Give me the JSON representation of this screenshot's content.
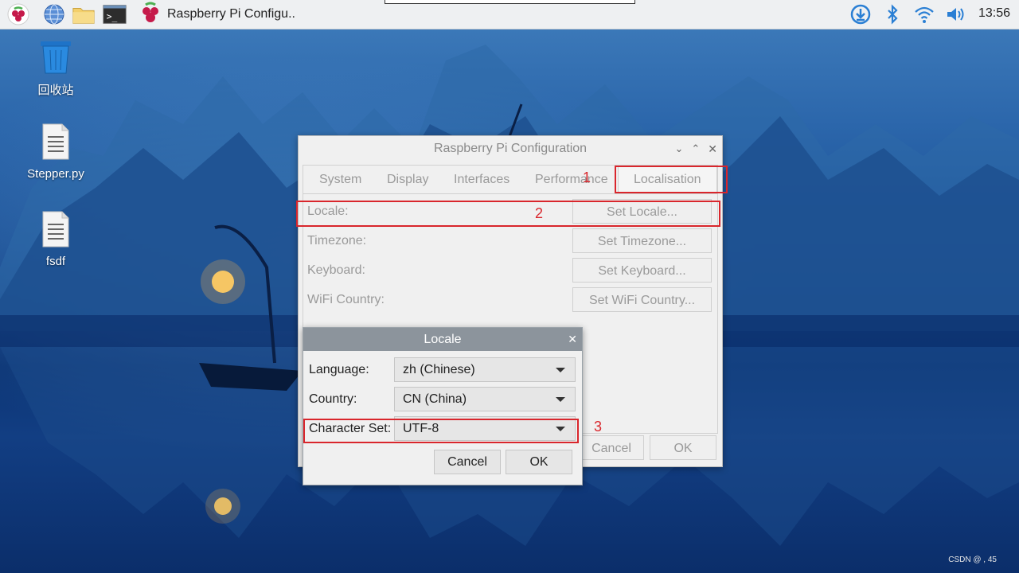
{
  "taskbar": {
    "task_label": "Raspberry Pi Configu..",
    "clock": "13:56",
    "icons": [
      "raspberry-menu-icon",
      "globe-icon",
      "folder-icon",
      "terminal-icon"
    ],
    "tray_icons": [
      "download-icon",
      "bluetooth-icon",
      "wifi-icon",
      "volume-icon"
    ]
  },
  "desktop": {
    "icons": [
      {
        "label": "回收站",
        "icon": "trash-icon"
      },
      {
        "label": "Stepper.py",
        "icon": "file-icon"
      },
      {
        "label": "fsdf",
        "icon": "file-icon"
      }
    ]
  },
  "config_window": {
    "title": "Raspberry Pi Configuration",
    "tabs": [
      "System",
      "Display",
      "Interfaces",
      "Performance",
      "Localisation"
    ],
    "active_tab": "Localisation",
    "rows": [
      {
        "label": "Locale:",
        "button": "Set Locale..."
      },
      {
        "label": "Timezone:",
        "button": "Set Timezone..."
      },
      {
        "label": "Keyboard:",
        "button": "Set Keyboard..."
      },
      {
        "label": "WiFi Country:",
        "button": "Set WiFi Country..."
      }
    ],
    "cancel": "Cancel",
    "ok": "OK"
  },
  "locale_dialog": {
    "title": "Locale",
    "language_label": "Language:",
    "language_value": "zh (Chinese)",
    "country_label": "Country:",
    "country_value": "CN (China)",
    "charset_label": "Character Set:",
    "charset_value": "UTF-8",
    "cancel": "Cancel",
    "ok": "OK"
  },
  "annotations": [
    "1",
    "2",
    "3"
  ],
  "watermark": "CSDN @ , 45",
  "colors": {
    "annotation": "#d9262c",
    "taskbar": "#eef0f2",
    "dialog_title": "#8c949c"
  }
}
